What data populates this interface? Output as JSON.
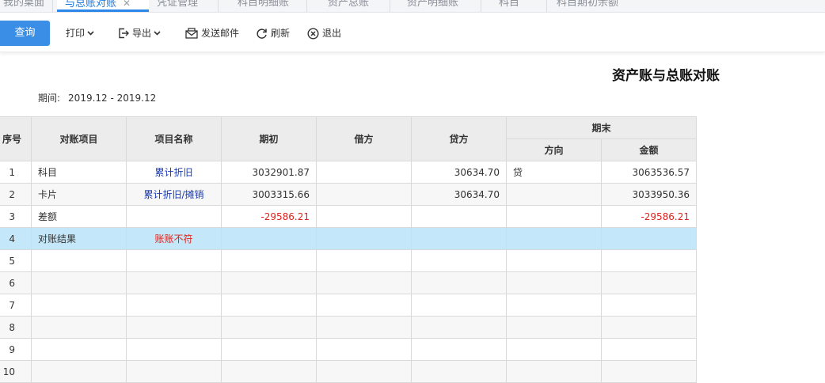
{
  "tabs": [
    {
      "label": "我的桌面",
      "active": false,
      "closable": false
    },
    {
      "label": "与总账对账",
      "active": true,
      "closable": true
    },
    {
      "label": "凭证管理",
      "active": false,
      "closable": false
    },
    {
      "label": "科目明细账",
      "active": false,
      "closable": false
    },
    {
      "label": "资产总账",
      "active": false,
      "closable": false
    },
    {
      "label": "资产明细账",
      "active": false,
      "closable": false
    },
    {
      "label": "科目",
      "active": false,
      "closable": false
    },
    {
      "label": "科目期初余额",
      "active": false,
      "closable": false
    }
  ],
  "tab_close_glyph": "✕",
  "toolbar": {
    "query": "查询",
    "print": "打印",
    "export": "导出",
    "send_email": "发送邮件",
    "refresh": "刷新",
    "exit": "退出"
  },
  "report": {
    "title": "资产账与总账对账",
    "period_label": "期间:",
    "period_value": "2019.12 - 2019.12"
  },
  "table": {
    "headers": {
      "seq": "序号",
      "item": "对账项目",
      "name": "项目名称",
      "opening": "期初",
      "debit": "借方",
      "credit": "贷方",
      "ending": "期末",
      "direction": "方向",
      "amount": "金额"
    },
    "rows": [
      {
        "seq": "1",
        "item": "科目",
        "name": "累计折旧",
        "opening": "3032901.87",
        "debit": "",
        "credit": "30634.70",
        "direction": "贷",
        "amount": "3063536.57"
      },
      {
        "seq": "2",
        "item": "卡片",
        "name": "累计折旧/摊销",
        "opening": "3003315.66",
        "debit": "",
        "credit": "30634.70",
        "direction": "",
        "amount": "3033950.36"
      },
      {
        "seq": "3",
        "item": "差额",
        "name": "",
        "opening": "-29586.21",
        "debit": "",
        "credit": "",
        "direction": "",
        "amount": "-29586.21"
      },
      {
        "seq": "4",
        "item": "对账结果",
        "name": "账账不符",
        "opening": "",
        "debit": "",
        "credit": "",
        "direction": "",
        "amount": ""
      },
      {
        "seq": "5",
        "item": "",
        "name": "",
        "opening": "",
        "debit": "",
        "credit": "",
        "direction": "",
        "amount": ""
      },
      {
        "seq": "6",
        "item": "",
        "name": "",
        "opening": "",
        "debit": "",
        "credit": "",
        "direction": "",
        "amount": ""
      },
      {
        "seq": "7",
        "item": "",
        "name": "",
        "opening": "",
        "debit": "",
        "credit": "",
        "direction": "",
        "amount": ""
      },
      {
        "seq": "8",
        "item": "",
        "name": "",
        "opening": "",
        "debit": "",
        "credit": "",
        "direction": "",
        "amount": ""
      },
      {
        "seq": "9",
        "item": "",
        "name": "",
        "opening": "",
        "debit": "",
        "credit": "",
        "direction": "",
        "amount": ""
      },
      {
        "seq": "10",
        "item": "",
        "name": "",
        "opening": "",
        "debit": "",
        "credit": "",
        "direction": "",
        "amount": ""
      }
    ]
  },
  "colors": {
    "accent": "#3a8ee6",
    "link_blue": "#1a3bb5",
    "negative_red": "#e0221b",
    "highlight_row": "#c4e8f9",
    "header_bg": "#ececec"
  }
}
